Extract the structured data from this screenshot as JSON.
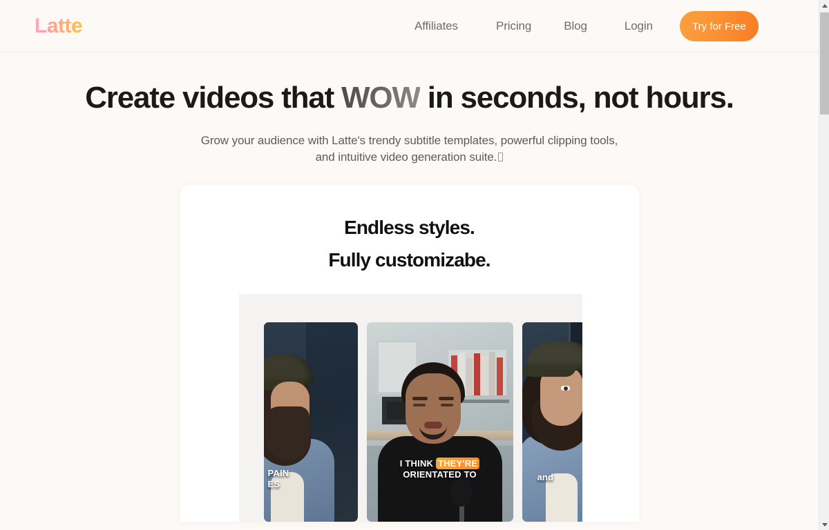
{
  "brand": {
    "name": "Latte"
  },
  "nav": {
    "links": [
      {
        "label": "Affiliates"
      },
      {
        "label": "Pricing"
      },
      {
        "label": "Blog"
      },
      {
        "label": "Login"
      }
    ],
    "cta": {
      "label": "Try for Free"
    }
  },
  "hero": {
    "headline_part1": "Create videos that ",
    "headline_emphasis": "WOW",
    "headline_part2": " in seconds, not hours.",
    "subhead": "Grow your audience with Latte's trendy subtitle templates, powerful clipping tools, and intuitive video generation suite."
  },
  "showcase": {
    "title_line1": "Endless styles.",
    "title_line2": "Fully customizabe.",
    "videos": [
      {
        "position": "left",
        "caption_line1": "PAIN",
        "caption_line2": "ES"
      },
      {
        "position": "center",
        "caption_pre": "I THINK ",
        "caption_highlight": "THEY'RE",
        "caption_line2": "ORIENTATED TO"
      },
      {
        "position": "right",
        "caption_line1": "and"
      }
    ]
  },
  "colors": {
    "page_background": "#fdf9f6",
    "card_background": "#ffffff",
    "stage_background": "#f5f3f1",
    "accent_orange": "#f98a22",
    "cta_gradient_start": "#fba03c",
    "cta_gradient_end": "#f97b23",
    "logo_gradient_start": "#ffadc8",
    "logo_gradient_end": "#ffc61f",
    "nav_link": "#6e6c6c",
    "headline": "#1a1a1a",
    "subhead": "#5d5b5b",
    "caption_highlight": "#f98a22",
    "scrollbar_track": "#f1f1f1",
    "scrollbar_thumb": "#c1c1c1"
  }
}
